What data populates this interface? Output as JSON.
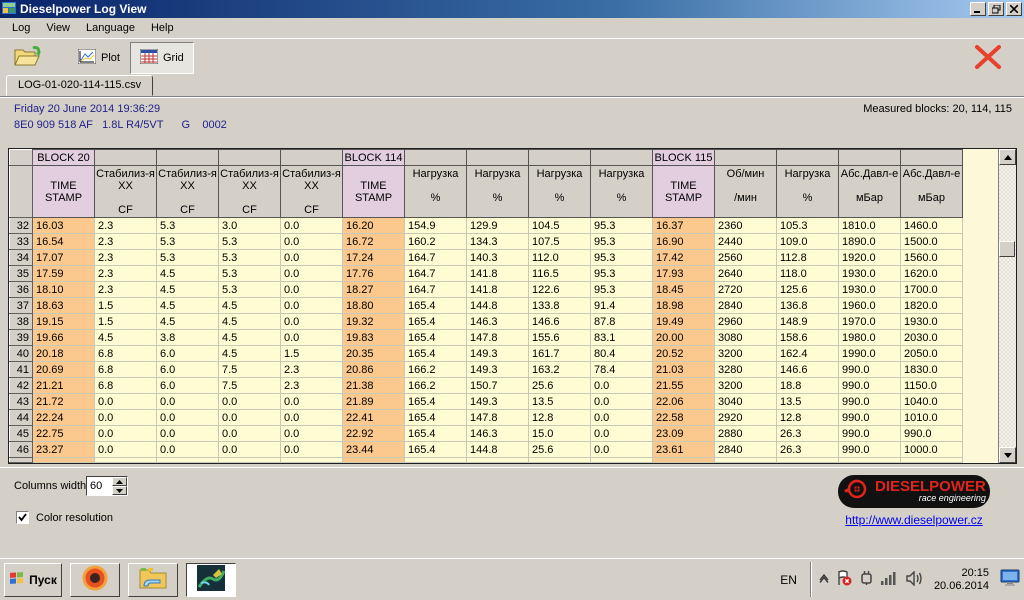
{
  "window": {
    "title": "Dieselpower Log View"
  },
  "menu": {
    "items": [
      "Log",
      "View",
      "Language",
      "Help"
    ]
  },
  "toolbar": {
    "plot_label": "Plot",
    "grid_label": "Grid"
  },
  "tab": {
    "label": "LOG-01-020-114-115.csv"
  },
  "info": {
    "datetime": "Friday 20 June 2014 19:36:29",
    "measured_blocks": "Measured blocks: 20, 114, 115",
    "vehicle": "8E0 909 518 AF   1.8L R4/5VT      G    0002"
  },
  "grid": {
    "columns": [
      {
        "block": "BLOCK 20",
        "lines": [
          "TIME",
          "STAMP"
        ],
        "time": true
      },
      {
        "lines": [
          "Стабилиз-я",
          "XX",
          "",
          "CF"
        ]
      },
      {
        "lines": [
          "Стабилиз-я",
          "XX",
          "",
          "CF"
        ]
      },
      {
        "lines": [
          "Стабилиз-я",
          "XX",
          "",
          "CF"
        ]
      },
      {
        "lines": [
          "Стабилиз-я",
          "XX",
          "",
          "CF"
        ]
      },
      {
        "block": "BLOCK 114",
        "lines": [
          "TIME",
          "STAMP"
        ],
        "time": true
      },
      {
        "lines": [
          "Нагрузка",
          "",
          "%"
        ]
      },
      {
        "lines": [
          "Нагрузка",
          "",
          "%"
        ]
      },
      {
        "lines": [
          "Нагрузка",
          "",
          "%"
        ]
      },
      {
        "lines": [
          "Нагрузка",
          "",
          "%"
        ]
      },
      {
        "block": "BLOCK 115",
        "lines": [
          "TIME",
          "STAMP"
        ],
        "time": true
      },
      {
        "lines": [
          "Об/мин",
          "",
          "/мин"
        ]
      },
      {
        "lines": [
          "Нагрузка",
          "",
          "%"
        ]
      },
      {
        "lines": [
          "Абс.Давл-е",
          "",
          "мБар"
        ]
      },
      {
        "lines": [
          "Абс.Давл-е",
          "",
          "мБар"
        ]
      }
    ],
    "rows": [
      {
        "num": "32",
        "cells": [
          "16.03",
          "2.3",
          "5.3",
          "3.0",
          "0.0",
          "16.20",
          "154.9",
          "129.9",
          "104.5",
          "95.3",
          "16.37",
          "2360",
          "105.3",
          "1810.0",
          "1460.0"
        ]
      },
      {
        "num": "33",
        "cells": [
          "16.54",
          "2.3",
          "5.3",
          "5.3",
          "0.0",
          "16.72",
          "160.2",
          "134.3",
          "107.5",
          "95.3",
          "16.90",
          "2440",
          "109.0",
          "1890.0",
          "1500.0"
        ]
      },
      {
        "num": "34",
        "cells": [
          "17.07",
          "2.3",
          "5.3",
          "5.3",
          "0.0",
          "17.24",
          "164.7",
          "140.3",
          "112.0",
          "95.3",
          "17.42",
          "2560",
          "112.8",
          "1920.0",
          "1560.0"
        ]
      },
      {
        "num": "35",
        "cells": [
          "17.59",
          "2.3",
          "4.5",
          "5.3",
          "0.0",
          "17.76",
          "164.7",
          "141.8",
          "116.5",
          "95.3",
          "17.93",
          "2640",
          "118.0",
          "1930.0",
          "1620.0"
        ]
      },
      {
        "num": "36",
        "cells": [
          "18.10",
          "2.3",
          "4.5",
          "5.3",
          "0.0",
          "18.27",
          "164.7",
          "141.8",
          "122.6",
          "95.3",
          "18.45",
          "2720",
          "125.6",
          "1930.0",
          "1700.0"
        ]
      },
      {
        "num": "37",
        "cells": [
          "18.63",
          "1.5",
          "4.5",
          "4.5",
          "0.0",
          "18.80",
          "165.4",
          "144.8",
          "133.8",
          "91.4",
          "18.98",
          "2840",
          "136.8",
          "1960.0",
          "1820.0"
        ]
      },
      {
        "num": "38",
        "cells": [
          "19.15",
          "1.5",
          "4.5",
          "4.5",
          "0.0",
          "19.32",
          "165.4",
          "146.3",
          "146.6",
          "87.8",
          "19.49",
          "2960",
          "148.9",
          "1970.0",
          "1930.0"
        ]
      },
      {
        "num": "39",
        "cells": [
          "19.66",
          "4.5",
          "3.8",
          "4.5",
          "0.0",
          "19.83",
          "165.4",
          "147.8",
          "155.6",
          "83.1",
          "20.00",
          "3080",
          "158.6",
          "1980.0",
          "2030.0"
        ]
      },
      {
        "num": "40",
        "cells": [
          "20.18",
          "6.8",
          "6.0",
          "4.5",
          "1.5",
          "20.35",
          "165.4",
          "149.3",
          "161.7",
          "80.4",
          "20.52",
          "3200",
          "162.4",
          "1990.0",
          "2050.0"
        ]
      },
      {
        "num": "41",
        "cells": [
          "20.69",
          "6.8",
          "6.0",
          "7.5",
          "2.3",
          "20.86",
          "166.2",
          "149.3",
          "163.2",
          "78.4",
          "21.03",
          "3280",
          "146.6",
          "990.0",
          "1830.0"
        ]
      },
      {
        "num": "42",
        "cells": [
          "21.21",
          "6.8",
          "6.0",
          "7.5",
          "2.3",
          "21.38",
          "166.2",
          "150.7",
          "25.6",
          "0.0",
          "21.55",
          "3200",
          "18.8",
          "990.0",
          "1150.0"
        ]
      },
      {
        "num": "43",
        "cells": [
          "21.72",
          "0.0",
          "0.0",
          "0.0",
          "0.0",
          "21.89",
          "165.4",
          "149.3",
          "13.5",
          "0.0",
          "22.06",
          "3040",
          "13.5",
          "990.0",
          "1040.0"
        ]
      },
      {
        "num": "44",
        "cells": [
          "22.24",
          "0.0",
          "0.0",
          "0.0",
          "0.0",
          "22.41",
          "165.4",
          "147.8",
          "12.8",
          "0.0",
          "22.58",
          "2920",
          "12.8",
          "990.0",
          "1010.0"
        ]
      },
      {
        "num": "45",
        "cells": [
          "22.75",
          "0.0",
          "0.0",
          "0.0",
          "0.0",
          "22.92",
          "165.4",
          "146.3",
          "15.0",
          "0.0",
          "23.09",
          "2880",
          "26.3",
          "990.0",
          "990.0"
        ]
      },
      {
        "num": "46",
        "cells": [
          "23.27",
          "0.0",
          "0.0",
          "0.0",
          "0.0",
          "23.44",
          "165.4",
          "144.8",
          "25.6",
          "0.0",
          "23.61",
          "2840",
          "26.3",
          "990.0",
          "1000.0"
        ]
      }
    ]
  },
  "footer": {
    "columns_width_label": "Columns width:",
    "columns_width_value": "60",
    "color_resolution_label": "Color resolution",
    "logo_title": "DIESELPOWER",
    "logo_subtitle": "race engineering",
    "link": "http://www.dieselpower.cz"
  },
  "taskbar": {
    "start_label": "Пуск",
    "language": "EN",
    "time": "20:15",
    "date": "20.06.2014"
  },
  "colors": {
    "titlebar_left": "#0a246a",
    "time_header_bg": "#e2cede",
    "time_cell_bg": "#fbc98d",
    "data_cell_bg": "#fffbd2",
    "logo_red": "#e0241c",
    "link_blue": "#0000ee",
    "close_x_red": "#e8402c"
  }
}
